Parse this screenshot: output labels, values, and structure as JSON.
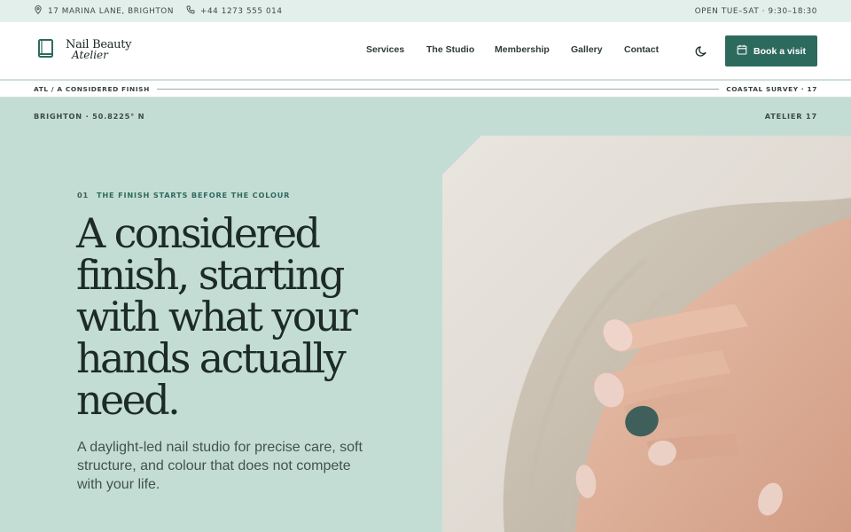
{
  "topbar": {
    "address": "17 MARINA LANE, BRIGHTON",
    "phone": "+44 1273 555 014",
    "hours": "OPEN TUE–SAT · 9:30–18:30"
  },
  "brand": {
    "name_line1": "Nail Beauty",
    "name_line2": "Atelier",
    "accent": "#2d6a5e",
    "background": "#c4ddd4"
  },
  "nav": {
    "items": [
      "Services",
      "The Studio",
      "Membership",
      "Gallery",
      "Contact"
    ],
    "theme_toggle_icon": "moon-icon",
    "cta_label": "Book a visit",
    "cta_icon": "calendar-icon"
  },
  "breadcrumb": {
    "left": "ATL / A CONSIDERED FINISH",
    "right": "COASTAL SURVEY · 17"
  },
  "meta": {
    "left": "BRIGHTON · 50.8225° N",
    "right": "ATELIER 17"
  },
  "hero": {
    "eyebrow_num": "01",
    "eyebrow_text": "THE FINISH STARTS BEFORE THE COLOUR",
    "headline": "A considered finish, starting with what your hands actually need.",
    "lede": "A daylight-led nail studio for precise care, soft structure, and colour that does not compete with your life.",
    "image_icon": "hands-photo"
  }
}
